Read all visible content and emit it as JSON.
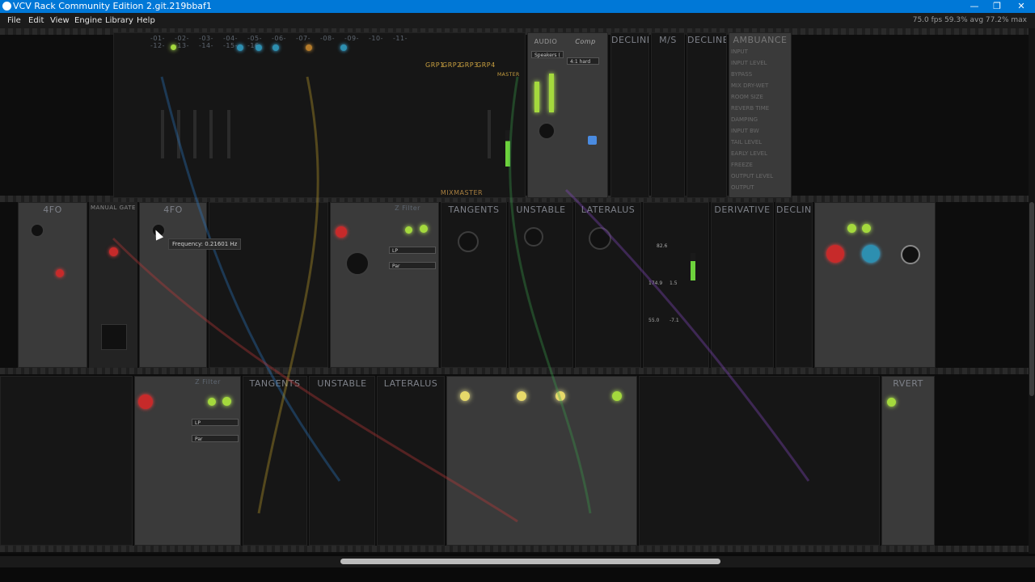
{
  "window": {
    "title": "VCV Rack Community Edition 2.git.219bbaf1",
    "min": "—",
    "restore": "❐",
    "close": "✕"
  },
  "menu": {
    "items": [
      "File",
      "Edit",
      "View",
      "Engine",
      "Library",
      "Help"
    ],
    "stats": "75.0 fps  59.3% avg  77.2% max"
  },
  "modules": {
    "mixmaster": {
      "channels": [
        "-01-",
        "-02-",
        "-03-",
        "-04-",
        "-05-",
        "-06-",
        "-07-",
        "-08-",
        "-09-",
        "-10-",
        "-11-",
        "-12-",
        "-13-",
        "-14-",
        "-15-",
        "-16-"
      ],
      "groups": [
        "GRP1",
        "GRP2",
        "GRP3",
        "GRP4"
      ],
      "master": "MASTER",
      "name": "MIXMASTER"
    },
    "audio": {
      "label": "AUDIO",
      "device": "Speakers (",
      "ratio": "4:1 hard",
      "comp": "Comp"
    },
    "decline1": "DECLINE",
    "ms": "M/S",
    "decline2": "DECLINE",
    "ambuance": {
      "title": "AMBUANCE",
      "params": [
        "INPUT",
        "INPUT LEVEL",
        "BYPASS",
        "MIX DRY-WET",
        "ROOM SIZE",
        "REVERB TIME",
        "DAMPING",
        "INPUT BW",
        "TAIL LEVEL",
        "EARLY LEVEL",
        "FREEZE",
        "OUTPUT LEVEL",
        "OUTPUT"
      ]
    },
    "lfo1": "4FO",
    "manual_gate": "MANUAL GATE",
    "lfo2": "4FO",
    "filter1": {
      "name": "Z Filter",
      "mode": "LP",
      "type": "Par"
    },
    "tangents": "TANGENTS",
    "unstable": "UNSTABLE",
    "lateralus": "LATERALUS",
    "derivative": "DERIVATIVE",
    "decline3": "DECLINE",
    "meter_values": {
      "a": "82.6",
      "b": "174.9",
      "c": "1.5",
      "d": "55.0",
      "e": "-7.1"
    },
    "filter2": {
      "name": "Z Filter",
      "mode": "LP",
      "type": "Par"
    },
    "tangents2": "TANGENTS",
    "unstable2": "UNSTABLE",
    "lateralus2": "LATERALUS",
    "rvert": "RVERT"
  },
  "tooltip": "Frequency: 0.21601 Hz",
  "colors": {
    "titlebar": "#0078d7",
    "menubar": "#1b1b1b",
    "rack": "#0d0d0d",
    "led_green": "#a4d93d",
    "led_yellow": "#e7d96a",
    "led_red": "#c72a2a"
  }
}
